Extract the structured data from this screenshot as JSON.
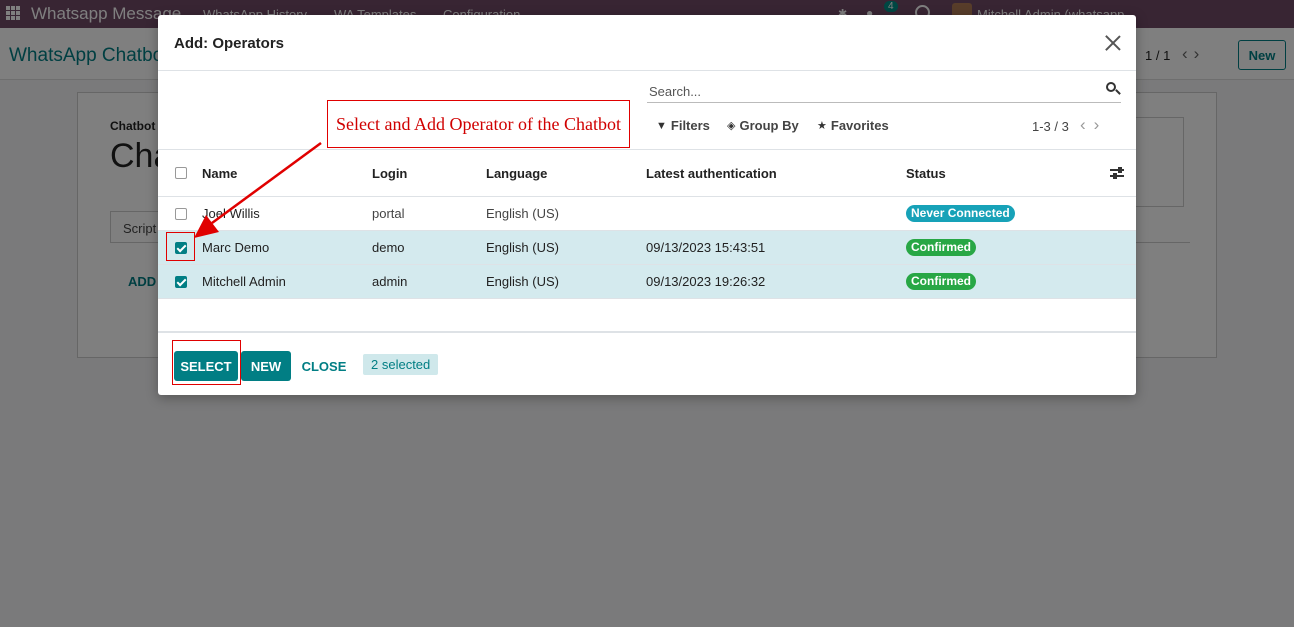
{
  "topbar": {
    "app_name": "Whatsapp Message",
    "menu": [
      "WhatsApp History",
      "WA Templates",
      "Configuration"
    ],
    "badge_count": "4",
    "user": "Mitchell Admin (whatsapp..."
  },
  "control": {
    "breadcrumb": "WhatsApp Chatbo",
    "pager": "1 / 1",
    "new_label": "New"
  },
  "form": {
    "label": "Chatbot",
    "title": "Cha",
    "tab": "Script",
    "add_label": "ADD"
  },
  "modal": {
    "title": "Add: Operators",
    "search_placeholder": "Search...",
    "filters": "Filters",
    "group_by": "Group By",
    "favorites": "Favorites",
    "pager": "1-3 / 3",
    "columns": [
      "Name",
      "Login",
      "Language",
      "Latest authentication",
      "Status"
    ],
    "rows": [
      {
        "name": "Joel Willis",
        "login": "portal",
        "language": "English (US)",
        "auth": "",
        "status": "Never Connected",
        "status_color": "#17a2b8",
        "checked": false
      },
      {
        "name": "Marc Demo",
        "login": "demo",
        "language": "English (US)",
        "auth": "09/13/2023 15:43:51",
        "status": "Confirmed",
        "status_color": "#28a745",
        "checked": true
      },
      {
        "name": "Mitchell Admin",
        "login": "admin",
        "language": "English (US)",
        "auth": "09/13/2023 19:26:32",
        "status": "Confirmed",
        "status_color": "#28a745",
        "checked": true
      }
    ],
    "select_label": "SELECT",
    "new_label": "NEW",
    "close_label": "CLOSE",
    "selected_count": "2 selected"
  },
  "annotation": {
    "text": "Select and Add Operator of the Chatbot",
    "color": "#e00000"
  },
  "colors": {
    "brand": "#714b67",
    "accent": "#017e84",
    "selected_row": "#d4eaee"
  }
}
